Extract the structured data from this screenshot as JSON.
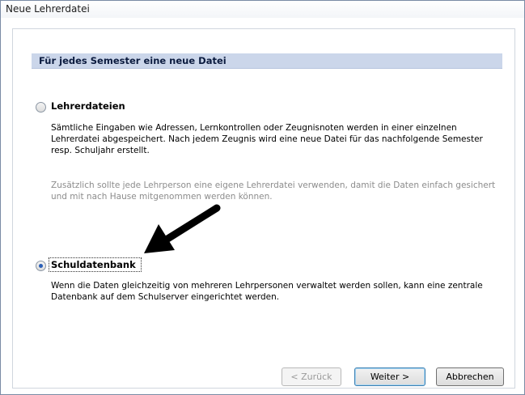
{
  "window": {
    "title": "Neue Lehrerdatei"
  },
  "section": {
    "title": "Für jedes Semester eine neue Datei"
  },
  "options": [
    {
      "label": "Lehrerdateien",
      "selected": false,
      "description": "Sämtliche Eingaben wie Adressen, Lernkontrollen oder Zeugnisnoten werden in einer einzelnen Lehrerdatei abgespeichert. Nach jedem Zeugnis wird eine neue Datei für das nachfolgende Semester resp. Schuljahr erstellt.",
      "note": "Zusätzlich sollte jede Lehrperson eine eigene Lehrerdatei verwenden, damit die Daten einfach gesichert und mit nach Hause mitgenommen werden können."
    },
    {
      "label": "Schuldatenbank",
      "selected": true,
      "description": "Wenn die Daten gleichzeitig von mehreren Lehrpersonen verwaltet werden sollen, kann eine zentrale Datenbank auf dem Schulserver eingerichtet werden."
    }
  ],
  "buttons": {
    "back": "< Zurück",
    "next": "Weiter >",
    "cancel": "Abbrechen"
  },
  "colors": {
    "header_bg": "#cbd6ea",
    "accent": "#2a5fb7",
    "annotation_arrow": "#000000"
  },
  "icons": {
    "annotation": "arrow-annotation-icon"
  }
}
